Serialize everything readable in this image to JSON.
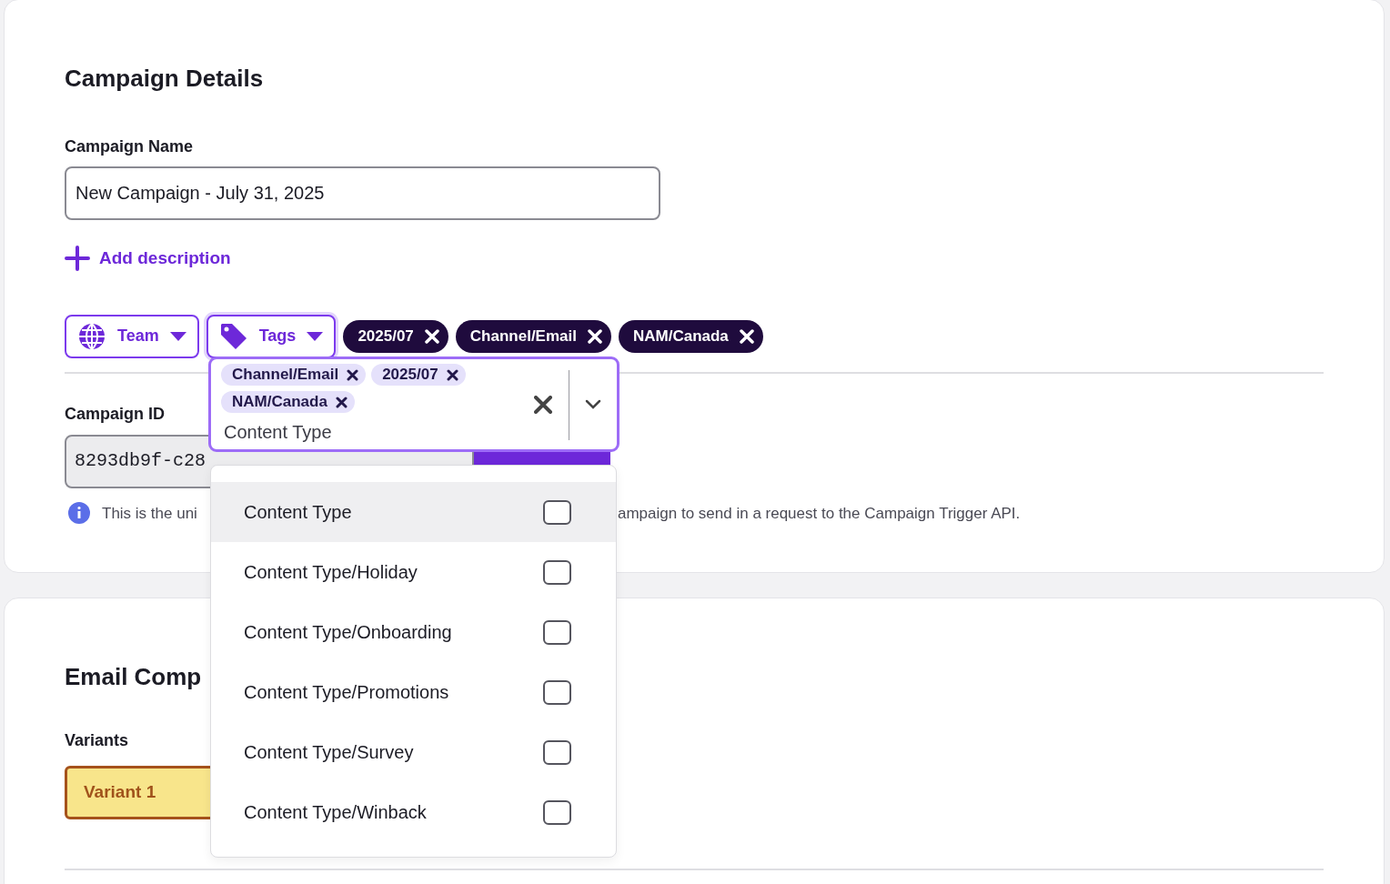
{
  "campaign_details": {
    "title": "Campaign Details",
    "name_label": "Campaign Name",
    "name_value": "New Campaign - July 31, 2025",
    "add_description": "Add description",
    "filters": [
      {
        "label": "Team",
        "kind": "team",
        "focused": false
      },
      {
        "label": "Tags",
        "kind": "tags",
        "focused": true
      }
    ],
    "applied_tags": [
      "2025/07",
      "Channel/Email",
      "NAM/Canada"
    ],
    "id_label": "Campaign ID",
    "id_value": "8293db9f-c28",
    "help_text": [
      "This is the uni",
      "ampaign to send in a request to the Campaign Trigger API."
    ]
  },
  "tag_picker": {
    "selected_tags": [
      "Channel/Email",
      "2025/07",
      "NAM/Canada"
    ],
    "search_value": "Content Type",
    "options": [
      {
        "label": "Content Type",
        "checked": false,
        "highlighted": true
      },
      {
        "label": "Content Type/Holiday",
        "checked": false,
        "highlighted": false
      },
      {
        "label": "Content Type/Onboarding",
        "checked": false,
        "highlighted": false
      },
      {
        "label": "Content Type/Promotions",
        "checked": false,
        "highlighted": false
      },
      {
        "label": "Content Type/Survey",
        "checked": false,
        "highlighted": false
      },
      {
        "label": "Content Type/Winback",
        "checked": false,
        "highlighted": false
      }
    ]
  },
  "email_section": {
    "title": "Email Comp",
    "variants_label": "Variants",
    "variants": [
      {
        "label": "Variant 1",
        "selected": true
      }
    ]
  }
}
